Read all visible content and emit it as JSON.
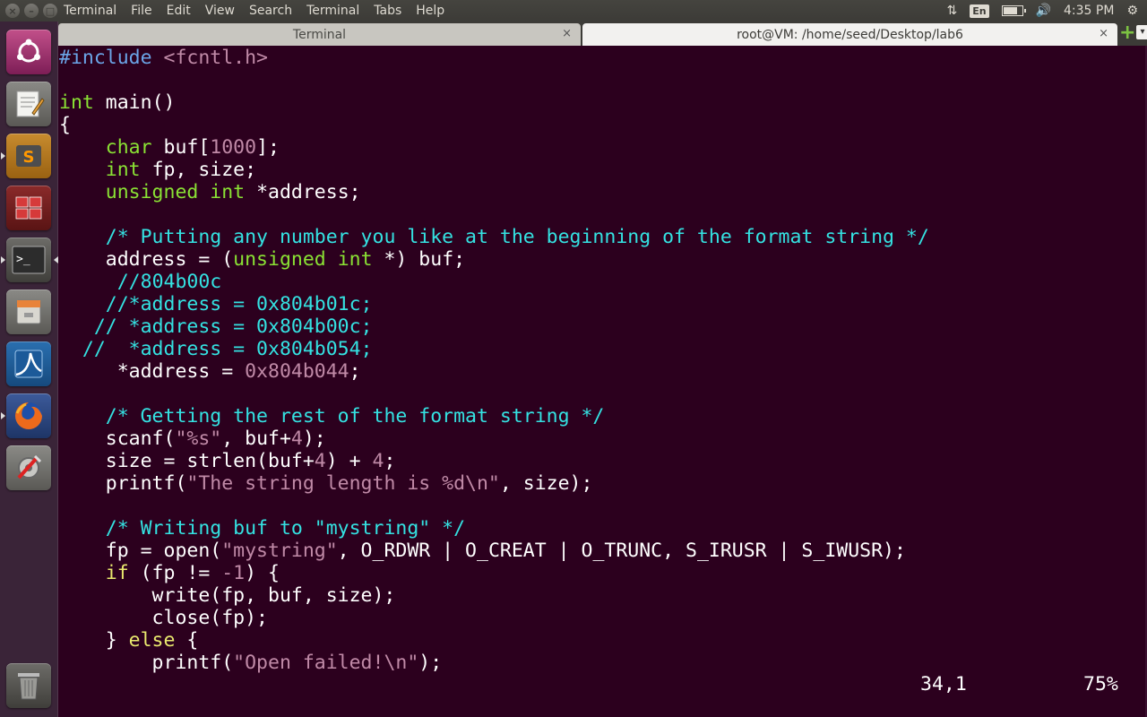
{
  "top_panel": {
    "menu": [
      "Terminal",
      "File",
      "Edit",
      "View",
      "Search",
      "Terminal",
      "Tabs",
      "Help"
    ],
    "keyboard_layout": "En",
    "clock": "4:35 PM",
    "battery_level": 0.75
  },
  "tabs": [
    {
      "title": "Terminal",
      "active": false
    },
    {
      "title": "root@VM: /home/seed/Desktop/lab6",
      "active": true
    }
  ],
  "launcher": {
    "apps": [
      "ubuntu-dash-icon",
      "text-editor-icon",
      "sublime-text-icon",
      "workspace-switcher-icon",
      "terminal-icon",
      "file-manager-icon",
      "wireshark-icon",
      "firefox-icon",
      "system-settings-icon",
      "trash-icon"
    ]
  },
  "editor": {
    "colors": {
      "preprocessor": "#6ba5e8",
      "type": "#8ae234",
      "statement": "#e9e96e",
      "string_number": "#c08aa7",
      "comment": "#34e2e2",
      "background": "#2c001e"
    },
    "lines": [
      [
        {
          "t": "#include ",
          "c": "kw-pre"
        },
        {
          "t": "<fcntl.h>",
          "c": "str"
        }
      ],
      [],
      [
        {
          "t": "int",
          "c": "kw-type"
        },
        {
          "t": " main()"
        }
      ],
      [
        {
          "t": "{"
        }
      ],
      [
        {
          "t": "    "
        },
        {
          "t": "char",
          "c": "kw-type"
        },
        {
          "t": " buf["
        },
        {
          "t": "1000",
          "c": "num"
        },
        {
          "t": "];"
        }
      ],
      [
        {
          "t": "    "
        },
        {
          "t": "int",
          "c": "kw-type"
        },
        {
          "t": " fp, size;"
        }
      ],
      [
        {
          "t": "    "
        },
        {
          "t": "unsigned",
          "c": "kw-type"
        },
        {
          "t": " "
        },
        {
          "t": "int",
          "c": "kw-type"
        },
        {
          "t": " *address;"
        }
      ],
      [],
      [
        {
          "t": "    "
        },
        {
          "t": "/* Putting any number you like at the beginning of the format string */",
          "c": "cmt"
        }
      ],
      [
        {
          "t": "    address = ("
        },
        {
          "t": "unsigned",
          "c": "kw-type"
        },
        {
          "t": " "
        },
        {
          "t": "int",
          "c": "kw-type"
        },
        {
          "t": " *) buf;"
        }
      ],
      [
        {
          "t": "     "
        },
        {
          "t": "//804b00c",
          "c": "cmt"
        }
      ],
      [
        {
          "t": "    "
        },
        {
          "t": "//*address = 0x804b01c;",
          "c": "cmt"
        }
      ],
      [
        {
          "t": "   "
        },
        {
          "t": "// *address = 0x804b00c;",
          "c": "cmt"
        }
      ],
      [
        {
          "t": "  "
        },
        {
          "t": "//  *address = 0x804b054;",
          "c": "cmt"
        }
      ],
      [
        {
          "t": "     *address = "
        },
        {
          "t": "0x804b044",
          "c": "num"
        },
        {
          "t": ";"
        }
      ],
      [],
      [
        {
          "t": "    "
        },
        {
          "t": "/* Getting the rest of the format string */",
          "c": "cmt"
        }
      ],
      [
        {
          "t": "    scanf("
        },
        {
          "t": "\"%s\"",
          "c": "str"
        },
        {
          "t": ", buf+"
        },
        {
          "t": "4",
          "c": "num"
        },
        {
          "t": ");"
        }
      ],
      [
        {
          "t": "    size = strlen(buf+"
        },
        {
          "t": "4",
          "c": "num"
        },
        {
          "t": ") + "
        },
        {
          "t": "4",
          "c": "num"
        },
        {
          "t": ";"
        }
      ],
      [
        {
          "t": "    printf("
        },
        {
          "t": "\"The string length is %d\\n\"",
          "c": "str"
        },
        {
          "t": ", size);"
        }
      ],
      [],
      [
        {
          "t": "    "
        },
        {
          "t": "/* Writing buf to \"mystring\" */",
          "c": "cmt"
        }
      ],
      [
        {
          "t": "    fp = open("
        },
        {
          "t": "\"mystring\"",
          "c": "str"
        },
        {
          "t": ", O_RDWR | O_CREAT | O_TRUNC, S_IRUSR | S_IWUSR);"
        }
      ],
      [
        {
          "t": "    "
        },
        {
          "t": "if",
          "c": "kw-stmt"
        },
        {
          "t": " (fp != "
        },
        {
          "t": "-1",
          "c": "num"
        },
        {
          "t": ") {"
        }
      ],
      [
        {
          "t": "        write(fp, buf, size);"
        }
      ],
      [
        {
          "t": "        close(fp);"
        }
      ],
      [
        {
          "t": "    } "
        },
        {
          "t": "else",
          "c": "kw-stmt"
        },
        {
          "t": " {"
        }
      ],
      [
        {
          "t": "        printf("
        },
        {
          "t": "\"Open failed!\\n\"",
          "c": "str"
        },
        {
          "t": ");"
        }
      ]
    ],
    "cursor_position": "34,1",
    "scroll_percent": "75%"
  }
}
